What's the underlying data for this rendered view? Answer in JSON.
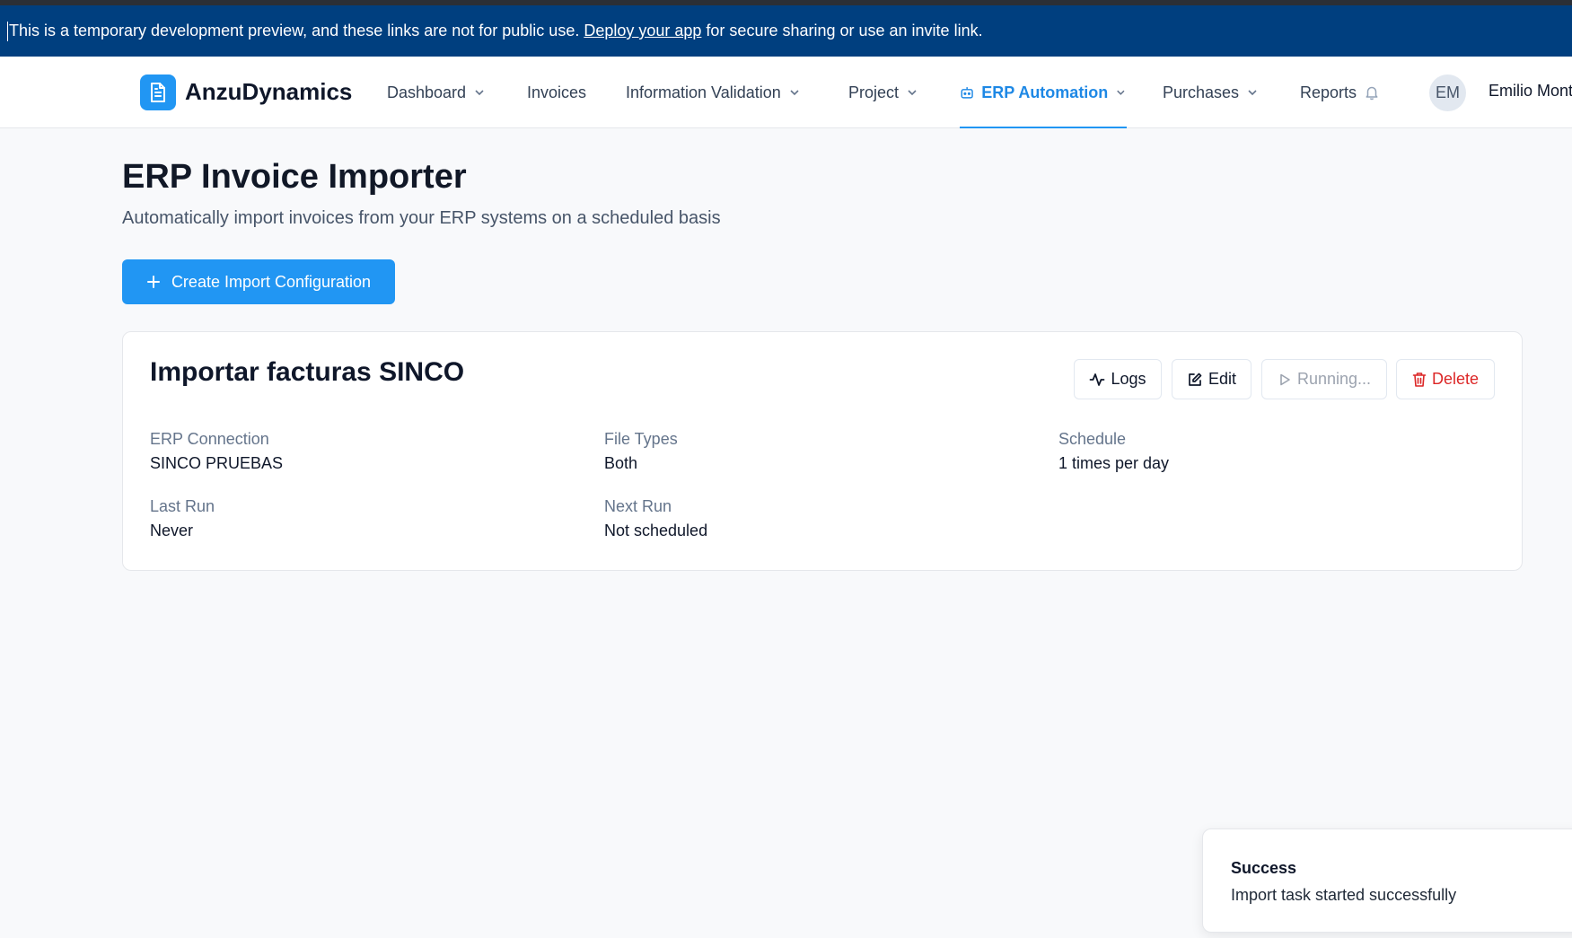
{
  "banner": {
    "text_before": "This is a temporary development preview, and these links are not for public use. ",
    "link": "Deploy your app",
    "text_after": " for secure sharing or use an invite link."
  },
  "navbar": {
    "brand": "AnzuDynamics",
    "items": [
      {
        "label": "Dashboard",
        "dropdown": true
      },
      {
        "label": "Invoices",
        "dropdown": false
      },
      {
        "label": "Information Validation",
        "dropdown": true
      },
      {
        "label": "Project",
        "dropdown": true
      },
      {
        "label": "ERP Automation",
        "dropdown": true,
        "active": true,
        "icon": "bot-icon"
      },
      {
        "label": "Purchases",
        "dropdown": true
      },
      {
        "label": "Reports",
        "dropdown": false,
        "icon": "bell-icon"
      }
    ],
    "avatar_initials": "EM",
    "user_name": "Emilio Mont"
  },
  "page": {
    "title": "ERP Invoice Importer",
    "subtitle": "Automatically import invoices from your ERP systems on a scheduled basis",
    "create_button": "Create Import Configuration"
  },
  "config_card": {
    "title": "Importar facturas SINCO",
    "actions": {
      "logs": "Logs",
      "edit": "Edit",
      "running": "Running...",
      "delete": "Delete"
    },
    "fields": {
      "erp_connection": {
        "label": "ERP Connection",
        "value": "SINCO PRUEBAS"
      },
      "file_types": {
        "label": "File Types",
        "value": "Both"
      },
      "schedule": {
        "label": "Schedule",
        "value": "1 times per day"
      },
      "last_run": {
        "label": "Last Run",
        "value": "Never"
      },
      "next_run": {
        "label": "Next Run",
        "value": "Not scheduled"
      }
    }
  },
  "toast": {
    "title": "Success",
    "message": "Import task started successfully"
  },
  "colors": {
    "banner_bg": "#003f7f",
    "accent": "#2196f3",
    "danger": "#dc2626",
    "muted": "#64748b"
  }
}
